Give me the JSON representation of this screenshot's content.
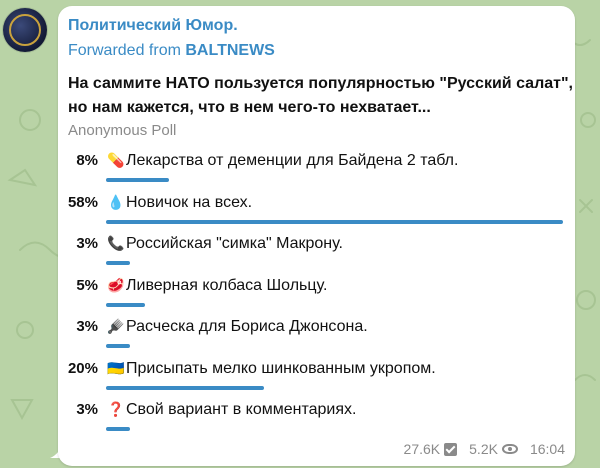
{
  "channel": {
    "name": "Политический Юмор.",
    "avatar_icon": "channel-avatar-globe"
  },
  "forwarded": {
    "prefix": "Forwarded from ",
    "source": "BALTNEWS"
  },
  "poll": {
    "question": "На саммите НАТО пользуется популярностью \"Русский салат\", но нам кажется, что в нем чего-то нехватает...",
    "type": "Anonymous Poll",
    "options": [
      {
        "percent_label": "8%",
        "percent": 8,
        "emoji": "💊",
        "text": "Лекарства от деменции для Байдена 2 табл."
      },
      {
        "percent_label": "58%",
        "percent": 58,
        "emoji": "💧",
        "text": "Новичок на всех."
      },
      {
        "percent_label": "3%",
        "percent": 3,
        "emoji": "📞",
        "text": "Российская \"симка\" Макрону."
      },
      {
        "percent_label": "5%",
        "percent": 5,
        "emoji": "🥩",
        "text": "Ливерная колбаса Шольцу."
      },
      {
        "percent_label": "3%",
        "percent": 3,
        "emoji": "🪮",
        "text": "Расческа для Бориса Джонсона."
      },
      {
        "percent_label": "20%",
        "percent": 20,
        "emoji": "🇺🇦",
        "text": "Присыпать мелко шинкованным укропом."
      },
      {
        "percent_label": "3%",
        "percent": 3,
        "emoji": "❓",
        "text": "Свой вариант в комментариях."
      }
    ]
  },
  "footer": {
    "votes": "27.6K",
    "views": "5.2K",
    "time": "16:04"
  },
  "colors": {
    "accent": "#3a8bc5",
    "background": "#b9d3a6",
    "bubble": "#ffffff",
    "muted": "#8a8a8a"
  }
}
